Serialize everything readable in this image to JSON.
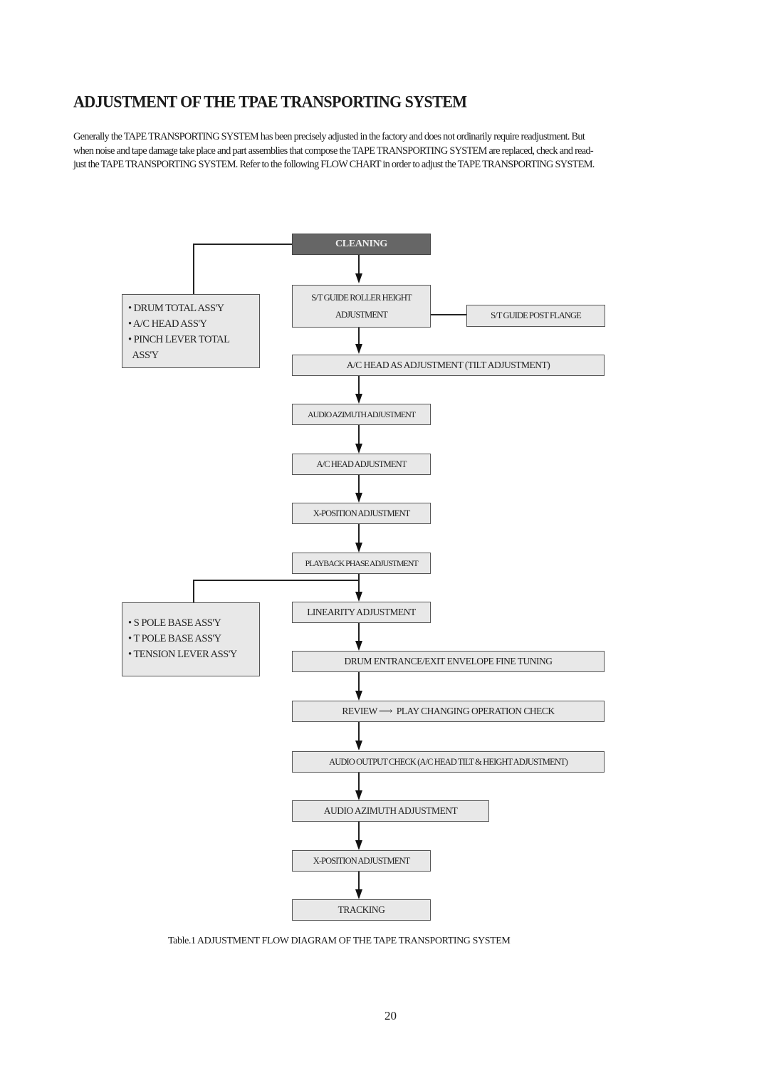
{
  "page": {
    "title": "ADJUSTMENT OF THE TPAE TRANSPORTING SYSTEM",
    "intro_lines": [
      "Generally the TAPE TRANSPORTING SYSTEM has been precisely adjusted in the factory and does not  ordinarily require readjustment. But",
      "when noise and tape damage take place and part assemblies that compose the TAPE TRANSPORTING SYSTEM are replaced, check and read-",
      "just the TAPE TRANSPORTING SYSTEM. Refer to the following FLOW CHART in order to adjust the TAPE TRANSPORTING SYSTEM."
    ],
    "caption": "Table.1 ADJUSTMENT FLOW DIAGRAM OF THE TAPE TRANSPORTING SYSTEM",
    "page_number": "20"
  },
  "flow": {
    "cleaning": "CLEANING",
    "st_guide_roller_line1": "S/T GUIDE ROLLER HEIGHT",
    "st_guide_roller_line2": "ADJUSTMENT",
    "st_guide_post_flange": "S/T GUIDE POST FLANGE",
    "ac_head_as": "A/C HEAD AS ADJUSTMENT (TILT ADJUSTMENT)",
    "audio_azimuth_1": "AUDIO AZIMUTH ADJUSTMENT",
    "ac_head": "A/C HEAD ADJUSTMENT",
    "x_position_1": "X-POSITION ADJUSTMENT",
    "playback_phase": "PLAYBACK PHASE ADJUSTMENT",
    "linearity": "LINEARITY ADJUSTMENT",
    "drum_envelope": "DRUM ENTRANCE/EXIT ENVELOPE FINE TUNING",
    "review_play_left": "REVIEW",
    "review_play_arrow": "⟶",
    "review_play_right": "PLAY CHANGING OPERATION CHECK",
    "audio_output": "AUDIO OUTPUT CHECK  (A/C HEAD TILT & HEIGHT ADJUSTMENT)",
    "audio_azimuth_2": "AUDIO AZIMUTH ADJUSTMENT",
    "x_position_2": "X-POSITION ADJUSTMENT",
    "tracking": "TRACKING"
  },
  "parts_group_1": {
    "items": [
      "•  DRUM TOTAL ASS'Y",
      "• A/C HEAD ASS'Y",
      "• PINCH LEVER TOTAL",
      "  ASS'Y"
    ]
  },
  "parts_group_2": {
    "items": [
      "•  S POLE BASE ASS'Y",
      "• T POLE BASE ASS'Y",
      "• TENSION LEVER ASS'Y"
    ]
  }
}
